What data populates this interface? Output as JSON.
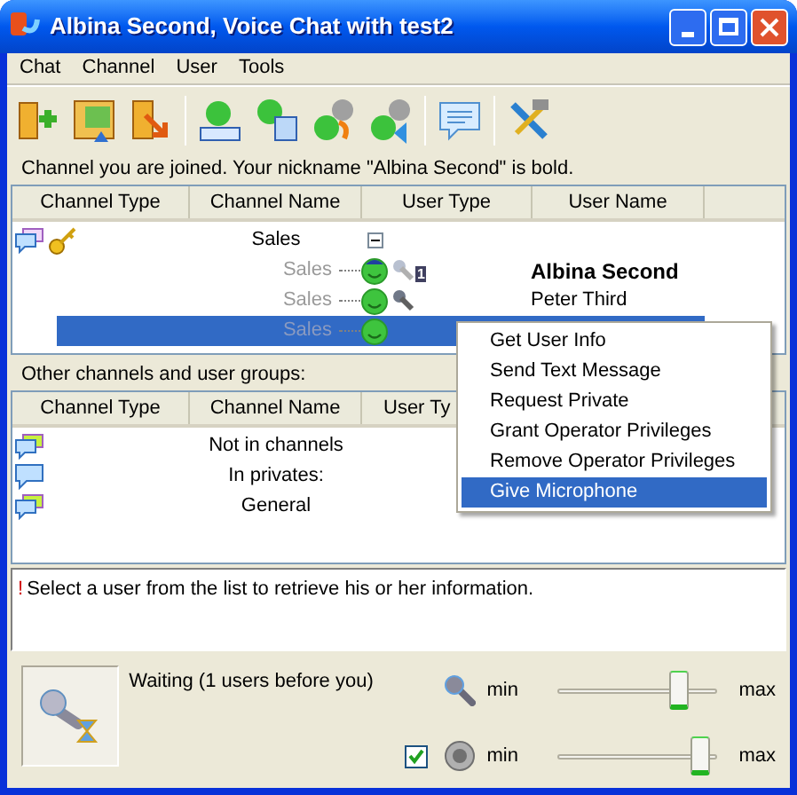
{
  "window": {
    "title": "Albina Second, Voice Chat with test2"
  },
  "menu": [
    "Chat",
    "Channel",
    "User",
    "Tools"
  ],
  "joined_label": "Channel you are joined. Your nickname \"Albina Second\" is bold.",
  "joined_table": {
    "columns": [
      "Channel Type",
      "Channel Name",
      "User Type",
      "User Name"
    ],
    "rows": [
      {
        "kind": "channel",
        "channel_name": "Sales",
        "expanded": true,
        "selected": false
      },
      {
        "kind": "user",
        "channel_name": "Sales",
        "operator": true,
        "microphone": true,
        "mic_badge": "1",
        "user_name": "Albina Second",
        "bold": true,
        "selected": false
      },
      {
        "kind": "user",
        "channel_name": "Sales",
        "operator": false,
        "microphone": true,
        "user_name": "Peter Third",
        "bold": false,
        "selected": false
      },
      {
        "kind": "user",
        "channel_name": "Sales",
        "operator": false,
        "microphone": false,
        "selected": true
      }
    ]
  },
  "other_label": "Other channels and user groups:",
  "other_table": {
    "columns": [
      "Channel Type",
      "Channel Name",
      "User Ty"
    ],
    "rows": [
      {
        "kind": "group",
        "channel_name": "Not in channels"
      },
      {
        "kind": "private",
        "channel_name": "In privates:"
      },
      {
        "kind": "group",
        "channel_name": "General"
      }
    ]
  },
  "context_menu": [
    {
      "label": "Get User Info",
      "selected": false
    },
    {
      "label": "Send Text Message",
      "selected": false
    },
    {
      "label": "Request Private",
      "selected": false
    },
    {
      "label": "Grant Operator Privileges",
      "selected": false
    },
    {
      "label": "Remove Operator Privileges",
      "selected": false
    },
    {
      "label": "Give Microphone",
      "selected": true
    }
  ],
  "info": {
    "marker": "!",
    "text": "Select a user from the list to retrieve his or her information."
  },
  "status": "Waiting (1 users before you)",
  "microphone_volume": {
    "min": "min",
    "max": "max",
    "level": 0.8
  },
  "speaker_volume": {
    "checked": true,
    "min": "min",
    "max": "max",
    "level": 0.95
  }
}
